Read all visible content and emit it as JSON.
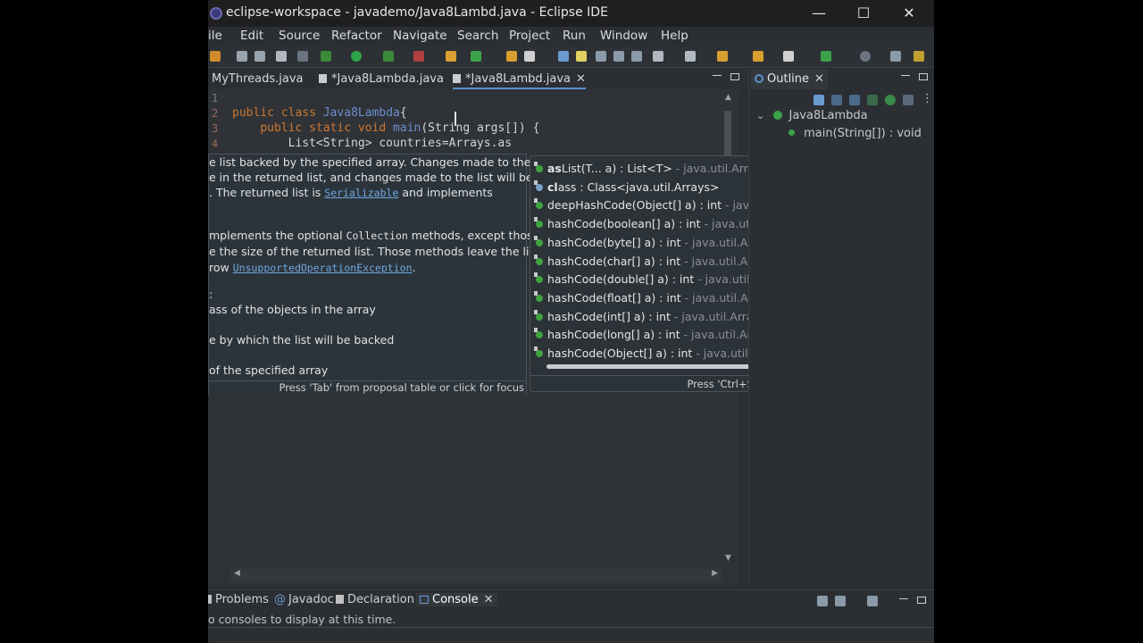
{
  "window": {
    "title": "eclipse-workspace - javademo/Java8Lambd.java - Eclipse IDE",
    "minimize_glyph": "—",
    "maximize_glyph": "☐",
    "close_glyph": "✕"
  },
  "menubar": [
    "ile",
    "Edit",
    "Source",
    "Refactor",
    "Navigate",
    "Search",
    "Project",
    "Run",
    "Window",
    "Help"
  ],
  "editor_tabs": [
    {
      "label": "MyThreads.java"
    },
    {
      "label": "*Java8Lambda.java"
    },
    {
      "label": "*Java8Lambd.java",
      "close": "✕"
    }
  ],
  "editor": {
    "line_numbers": [
      "1",
      "2",
      "3",
      "4"
    ],
    "lines": [
      "",
      "public class Java8Lambda{",
      "    public static void main(String args[]) {",
      "        List<String> countries=Arrays.as"
    ]
  },
  "javadoc": {
    "l1": "e list backed by the specified array. Changes made to the",
    "l2": "e in the returned list, and changes made to the list will be",
    "l3a": ". The returned list is ",
    "l3b": "Serializable",
    "l3c": " and implements",
    "l4a": "mplements the optional ",
    "l4b": "Collection",
    "l4c": " methods, except those",
    "l5": "e the size of the returned list. Those methods leave the list",
    "l6a": "row ",
    "l6b": "UnsupportedOperationException",
    "l6c": ".",
    "l7": ":",
    "l8": "ass of the objects in the array",
    "l9": "e by which the list will be backed",
    "l10": "of the specified array",
    "footer": "Press 'Tab' from proposal table or click for focus"
  },
  "proposals": {
    "items": [
      {
        "bold": "as",
        "rest": "List(T... a) : List<T>",
        "dim": " - java.util.Arrays",
        "icon": "method"
      },
      {
        "bold": "cl",
        "rest": "ass : Class<java.util.Arrays>",
        "dim": "",
        "icon": "class"
      },
      {
        "bold": "",
        "rest": "deepHashCode(Object[] a) : int",
        "dim": " - java.util.Arrays",
        "icon": "method"
      },
      {
        "bold": "",
        "rest": "hashCode(boolean[] a) : int",
        "dim": " - java.util.Arrays",
        "icon": "method"
      },
      {
        "bold": "",
        "rest": "hashCode(byte[] a) : int",
        "dim": " - java.util.Arrays",
        "icon": "method"
      },
      {
        "bold": "",
        "rest": "hashCode(char[] a) : int",
        "dim": " - java.util.Arrays",
        "icon": "method"
      },
      {
        "bold": "",
        "rest": "hashCode(double[] a) : int",
        "dim": " - java.util.Arrays",
        "icon": "method"
      },
      {
        "bold": "",
        "rest": "hashCode(float[] a) : int",
        "dim": " - java.util.Arrays",
        "icon": "method"
      },
      {
        "bold": "",
        "rest": "hashCode(int[] a) : int",
        "dim": " - java.util.Arrays",
        "icon": "method"
      },
      {
        "bold": "",
        "rest": "hashCode(long[] a) : int",
        "dim": " - java.util.Arrays",
        "icon": "method"
      },
      {
        "bold": "",
        "rest": "hashCode(Object[] a) : int",
        "dim": " - java.util.Arrays",
        "icon": "method"
      }
    ],
    "footer": "Press 'Ctrl+Space' to show Template Proposals"
  },
  "outline": {
    "tab_label": "Outline",
    "close": "✕",
    "class_name": "Java8Lambda",
    "method": "main(String[]) : void"
  },
  "bottom_tabs": [
    "Problems",
    "Javadoc",
    "Declaration",
    "Console"
  ],
  "console_close": "✕",
  "console_message": "o consoles to display at this time."
}
